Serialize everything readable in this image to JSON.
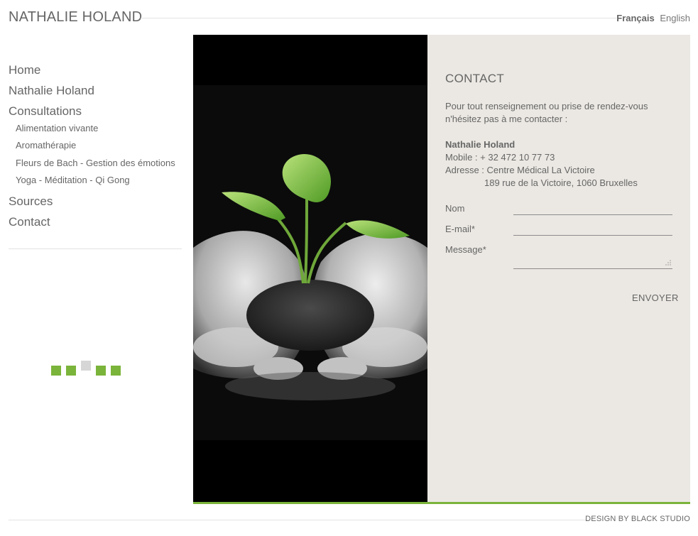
{
  "header": {
    "site_title": "NATHALIE HOLAND",
    "languages": [
      {
        "label": "Français",
        "active": true
      },
      {
        "label": "English",
        "active": false
      }
    ]
  },
  "nav": {
    "items": [
      {
        "label": "Home"
      },
      {
        "label": "Nathalie Holand"
      },
      {
        "label": "Consultations"
      }
    ],
    "subitems": [
      {
        "label": "Alimentation vivante"
      },
      {
        "label": "Aromathérapie"
      },
      {
        "label": "Fleurs de Bach - Gestion des émotions"
      },
      {
        "label": "Yoga - Méditation - Qi Gong"
      }
    ],
    "items_after": [
      {
        "label": "Sources"
      },
      {
        "label": "Contact"
      }
    ]
  },
  "contact": {
    "title": "CONTACT",
    "intro_line1": "Pour tout renseignement ou prise de rendez-vous",
    "intro_line2": "n'hésitez pas à me contacter :",
    "name": "Nathalie Holand",
    "mobile": "Mobile : + 32 472 10 77 73",
    "address_line1": "Adresse : Centre Médical La Victoire",
    "address_line2": "189 rue de la Victoire, 1060 Bruxelles",
    "form": {
      "nom_label": "Nom",
      "email_label": "E-mail*",
      "message_label": "Message*",
      "nom_value": "",
      "email_value": "",
      "message_value": "",
      "submit_label": "ENVOYER"
    }
  },
  "image": {
    "icon": "plant-in-hands-photo"
  },
  "loader": {
    "icon": "loading-squares"
  },
  "footer": {
    "credit": "DESIGN BY BLACK STUDIO"
  },
  "colors": {
    "accent": "#7bb43a",
    "panel_bg": "#ebe8e3",
    "text": "#666666"
  }
}
